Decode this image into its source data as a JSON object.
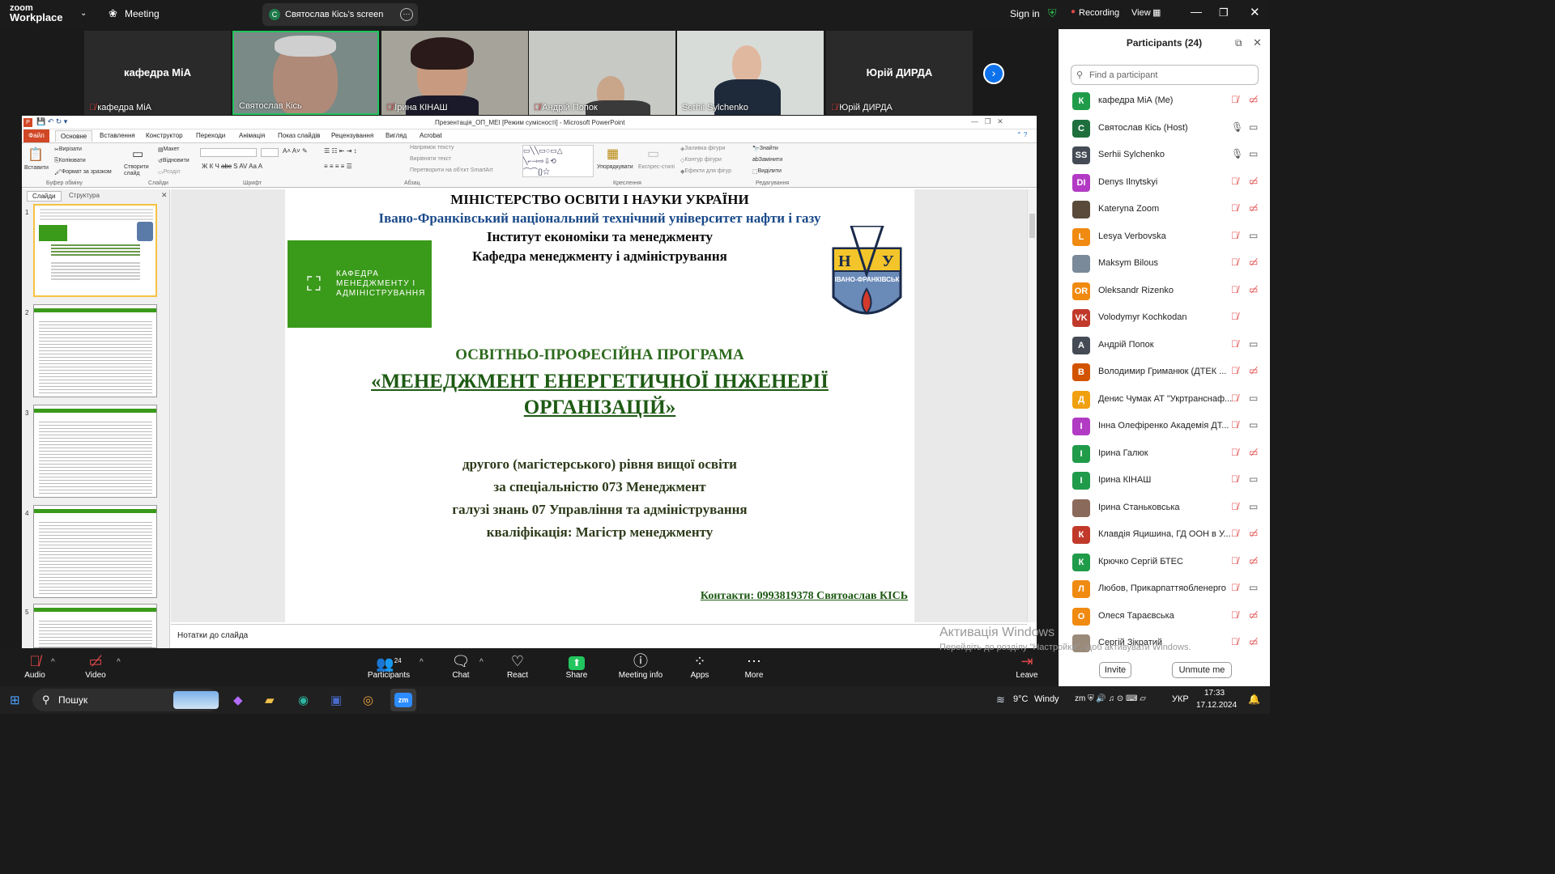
{
  "zoom": {
    "brand_line1": "zoom",
    "brand_line2": "Workplace",
    "meeting_label": "Meeting",
    "screen_tab_initial": "C",
    "screen_tab_label": "Святослав Кісь's screen",
    "sign_in": "Sign in",
    "recording": "Recording",
    "view": "View"
  },
  "thumbnails": [
    {
      "name": "кафедра МіА",
      "big": "кафедра МіА",
      "muted": true
    },
    {
      "name": "Святослав Кісь",
      "muted": false
    },
    {
      "name": "Ірина КІНАШ",
      "muted": true
    },
    {
      "name": "Андрій Попок",
      "muted": true
    },
    {
      "name": "Serhii Sylchenko",
      "muted": false
    },
    {
      "name": "Юрій ДИРДА",
      "big": "Юрій ДИРДА",
      "muted": true
    }
  ],
  "ppt": {
    "window_title": "Презентація_ОП_МЕІ [Режим сумісності] - Microsoft PowerPoint",
    "file_tab": "Файл",
    "tabs": [
      "Основне",
      "Вставлення",
      "Конструктор",
      "Переходи",
      "Анімація",
      "Показ слайдів",
      "Рецензування",
      "Вигляд",
      "Acrobat"
    ],
    "ribbon": {
      "paste": "Вставити",
      "cut": "Вирізати",
      "copy": "Копіювати",
      "format_painter": "Формат за зразком",
      "clipboard": "Буфер обміну",
      "new_slide": "Створити слайд",
      "layout": "Макет",
      "reset": "Відновити",
      "section": "Розділ",
      "slides": "Слайди",
      "font": "Шрифт",
      "text_direction": "Напрямок тексту",
      "align_text": "Вирівняти текст",
      "smartart": "Перетворити на об'єкт SmartArt",
      "paragraph": "Абзац",
      "arrange": "Упорядкувати",
      "quick_styles": "Експрес-стилі",
      "shape_fill": "Заливка фігури",
      "shape_outline": "Контур фігури",
      "shape_effects": "Ефекти для фігур",
      "drawing": "Креслення",
      "find": "Знайти",
      "replace": "Замінити",
      "select": "Виділити",
      "editing": "Редагування"
    },
    "panel_tabs": [
      "Слайди",
      "Структура"
    ],
    "slide_numbers": [
      "1",
      "2",
      "3",
      "4",
      "5"
    ],
    "notes_placeholder": "Нотатки до слайда",
    "slide": {
      "line1": "МІНІСТЕРСТВО ОСВІТИ І НАУКИ УКРАЇНИ",
      "line2": "Івано-Франківський  національний  технічний університет нафти і газу",
      "line3": "Інститут економіки та менеджменту",
      "line4": "Кафедра менеджменту і адміністрування",
      "box_text": "КАФЕДРА МЕНЕДЖМЕНТУ І АДМІНІСТРУВАННЯ",
      "logo_text": "ІВАНО-ФРАНКІВСЬК",
      "program_label": "ОСВІТНЬО-ПРОФЕСІЙНА ПРОГРАМА",
      "program_name1": "«МЕНЕДЖМЕНТ ЕНЕРГЕТИЧНОЇ ІНЖЕНЕРІЇ",
      "program_name2": "ОРГАНІЗАЦІЙ»",
      "level": "другого (магістерського) рівня вищої освіти",
      "specialty": "за спеціальністю 073 Менеджмент",
      "field": "галузі знань 07 Управління  та адміністрування",
      "qualification": "кваліфікація:  Магістр менеджменту",
      "contacts": "Контакти: 0993819378  Святоаслав КІСЬ"
    }
  },
  "participants": {
    "header": "Participants (24)",
    "search_placeholder": "Find a participant",
    "list": [
      {
        "initials": "К",
        "name": "кафедра МіА (Me)",
        "color": "#1f9b4a",
        "mic": "muted",
        "video": "off"
      },
      {
        "initials": "С",
        "name": "Святослав Кісь (Host)",
        "color": "#1e6f3d",
        "mic": "on",
        "video": "on"
      },
      {
        "initials": "SS",
        "name": "Serhii Sylchenko",
        "color": "#444b55",
        "mic": "on",
        "video": "on"
      },
      {
        "initials": "DI",
        "name": "Denys Ilnytskyi",
        "color": "#b23bc4",
        "mic": "muted",
        "video": "off"
      },
      {
        "initials": "",
        "name": "Kateryna Zoom",
        "color": "#5a4a3a",
        "mic": "muted",
        "video": "off"
      },
      {
        "initials": "L",
        "name": "Lesya Verbovska",
        "color": "#f08a10",
        "mic": "muted",
        "video": "on"
      },
      {
        "initials": "",
        "name": "Maksym Bilous",
        "color": "#7a8a9a",
        "mic": "muted",
        "video": "off"
      },
      {
        "initials": "OR",
        "name": "Oleksandr Rizenko",
        "color": "#f08a10",
        "mic": "muted",
        "video": "off"
      },
      {
        "initials": "VK",
        "name": "Volodymyr Kochkodan",
        "color": "#c0392b",
        "mic": "muted",
        "video": "none"
      },
      {
        "initials": "А",
        "name": "Андрій Попок",
        "color": "#444b55",
        "mic": "muted",
        "video": "on"
      },
      {
        "initials": "В",
        "name": "Володимир Гриманюк (ДТЕК ...",
        "color": "#d35400",
        "mic": "muted",
        "video": "off"
      },
      {
        "initials": "Д",
        "name": "Денис Чумак АТ \"Укртранснаф...",
        "color": "#f0a010",
        "mic": "muted",
        "video": "on"
      },
      {
        "initials": "І",
        "name": "Інна Олефіренко Академія ДТ...",
        "color": "#b23bc4",
        "mic": "muted",
        "video": "on"
      },
      {
        "initials": "І",
        "name": "Ірина Галюк",
        "color": "#1f9b4a",
        "mic": "muted",
        "video": "off"
      },
      {
        "initials": "І",
        "name": "Ірина КІНАШ",
        "color": "#1f9b4a",
        "mic": "muted",
        "video": "on"
      },
      {
        "initials": "",
        "name": "Ірина Станьковська",
        "color": "#8a6a5a",
        "mic": "muted",
        "video": "on"
      },
      {
        "initials": "К",
        "name": "Клавдія Яцишина, ГД ООН в У...",
        "color": "#c0392b",
        "mic": "muted",
        "video": "off"
      },
      {
        "initials": "К",
        "name": "Крючко Сергій БТЕС",
        "color": "#1f9b4a",
        "mic": "muted",
        "video": "off"
      },
      {
        "initials": "Л",
        "name": "Любов, Прикарпаттяобленерго",
        "color": "#f08a10",
        "mic": "muted",
        "video": "on"
      },
      {
        "initials": "О",
        "name": "Олеся Тараєвська",
        "color": "#f08a10",
        "mic": "muted",
        "video": "off"
      },
      {
        "initials": "",
        "name": "Сергій Зікратий",
        "color": "#9a8a7a",
        "mic": "muted",
        "video": "off"
      }
    ],
    "invite": "Invite",
    "unmute_me": "Unmute me"
  },
  "toolbar": {
    "audio": "Audio",
    "video": "Video",
    "participants": "Participants",
    "participants_count": "24",
    "chat": "Chat",
    "react": "React",
    "share": "Share",
    "meeting_info": "Meeting info",
    "apps": "Apps",
    "more": "More",
    "leave": "Leave"
  },
  "windows": {
    "watermark_title": "Активація Windows",
    "watermark_sub": "Перейдіть до розділу \"Настройки\", щоб активувати Windows.",
    "search": "Пошук",
    "weather_temp": "9°C",
    "weather_desc": "Windy",
    "lang": "УКР",
    "time": "17:33",
    "date": "17.12.2024"
  }
}
